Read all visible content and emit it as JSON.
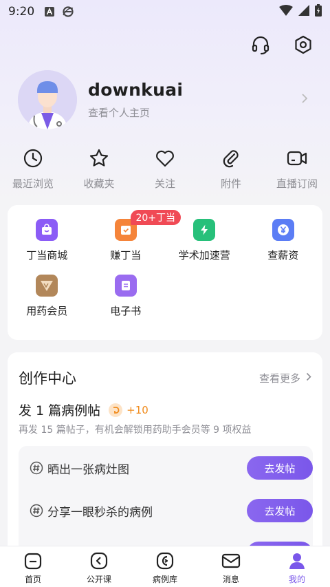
{
  "status_bar": {
    "time": "9:20",
    "icons": [
      "a-icon",
      "browser-e-icon",
      "wifi-icon",
      "signal-icon",
      "battery-icon"
    ]
  },
  "header": {
    "actions": [
      "headset-icon",
      "settings-hex-icon"
    ]
  },
  "profile": {
    "username": "downkuai",
    "subtitle": "查看个人主页"
  },
  "quick_links": [
    {
      "label": "最近浏览",
      "icon": "clock-icon"
    },
    {
      "label": "收藏夹",
      "icon": "star-icon"
    },
    {
      "label": "关注",
      "icon": "heart-icon"
    },
    {
      "label": "附件",
      "icon": "paperclip-icon"
    },
    {
      "label": "直播订阅",
      "icon": "video-icon"
    }
  ],
  "services": {
    "badge": "20+丁当",
    "items": [
      {
        "label": "丁当商城",
        "icon": "bag-icon",
        "color": "#8b5cf6"
      },
      {
        "label": "赚丁当",
        "icon": "calendar-icon",
        "color": "#f5843a"
      },
      {
        "label": "学术加速营",
        "icon": "lightning-icon",
        "color": "#27c07a"
      },
      {
        "label": "查薪资",
        "icon": "yen-icon",
        "color": "#5b7df5"
      },
      {
        "label": "用药会员",
        "icon": "vip-icon",
        "color": "#b2875a"
      },
      {
        "label": "电子书",
        "icon": "ebook-icon",
        "color": "#9a6cf0"
      }
    ]
  },
  "create_center": {
    "title": "创作中心",
    "more": "查看更多",
    "task_title": "发 1 篇病例帖",
    "task_points": "+10",
    "hint": "再发 15 篇帖子，有机会解锁用药助手会员等 9 项权益",
    "topics": [
      {
        "label": "晒出一张病灶图",
        "button": "去发帖"
      },
      {
        "label": "分享一眼秒杀的病例",
        "button": "去发帖"
      }
    ]
  },
  "tabs": [
    {
      "label": "首页",
      "icon": "home-icon"
    },
    {
      "label": "公开课",
      "icon": "play-icon"
    },
    {
      "label": "病例库",
      "icon": "case-library-icon"
    },
    {
      "label": "消息",
      "icon": "mail-icon"
    },
    {
      "label": "我的",
      "icon": "user-icon",
      "active": true
    }
  ],
  "colors": {
    "accent": "#7a57ea",
    "badge": "#f04a55",
    "points": "#f08a1a"
  }
}
